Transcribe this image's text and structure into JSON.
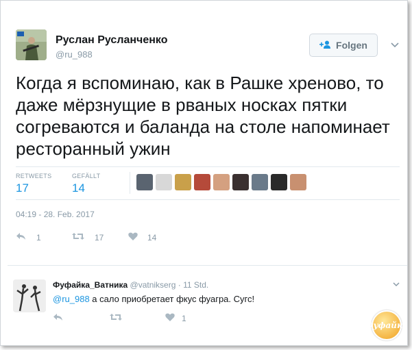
{
  "tweet": {
    "author_name": "Руслан Русланченко",
    "author_handle": "@ru_988",
    "follow_label": "Folgen",
    "text": "Когда я вспоминаю, как в Рашке хреново, то даже мёрзнущие в рваных носках пятки согреваются и баланда на столе напоминает ресторанный ужин",
    "retweets_label": "RETWEETS",
    "retweets_count": "17",
    "likes_label": "GEFÄLLT",
    "likes_count": "14",
    "timestamp": "04:19 - 28. Feb. 2017",
    "actions": {
      "reply": "1",
      "retweet": "17",
      "like": "14"
    },
    "liker_colors": [
      "#5a6470",
      "#d8d8d8",
      "#c9a04a",
      "#b54a3a",
      "#d4a080",
      "#3a3030",
      "#6a7a8a",
      "#2a2a2a",
      "#c89070"
    ]
  },
  "reply": {
    "author_name": "Фуфайка_Ватника",
    "author_handle": "@vatnikserg",
    "time": "11 Std.",
    "mention": "@ru_988",
    "text": " а сало приобретает фкус фуагра. Сугс!",
    "actions": {
      "like": "1"
    }
  },
  "watermark": "Фуфайка"
}
